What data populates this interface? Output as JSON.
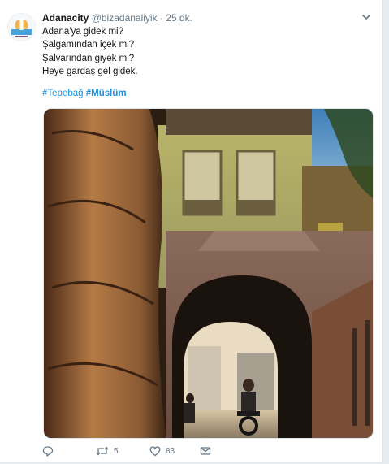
{
  "tweet": {
    "display_name": "Adanacity",
    "handle": "@bizadanaliyik",
    "separator": "·",
    "time": "25 dk.",
    "lines": [
      "Adana'ya gidek mi?",
      "Şalgamından içek mi?",
      "Şalvarından giyek mi?",
      "Heye gardaş gel gidek."
    ],
    "hashtags": [
      "#Tepebağ",
      "#Müslüm"
    ]
  },
  "actions": {
    "reply_count": "",
    "retweet_count": "5",
    "like_count": "83"
  },
  "icons": {
    "caret": "chevron-down-icon",
    "reply": "reply-icon",
    "retweet": "retweet-icon",
    "like": "heart-icon",
    "dm": "message-icon"
  },
  "colors": {
    "link": "#1b95e0",
    "muted": "#657786",
    "text": "#14171a"
  }
}
